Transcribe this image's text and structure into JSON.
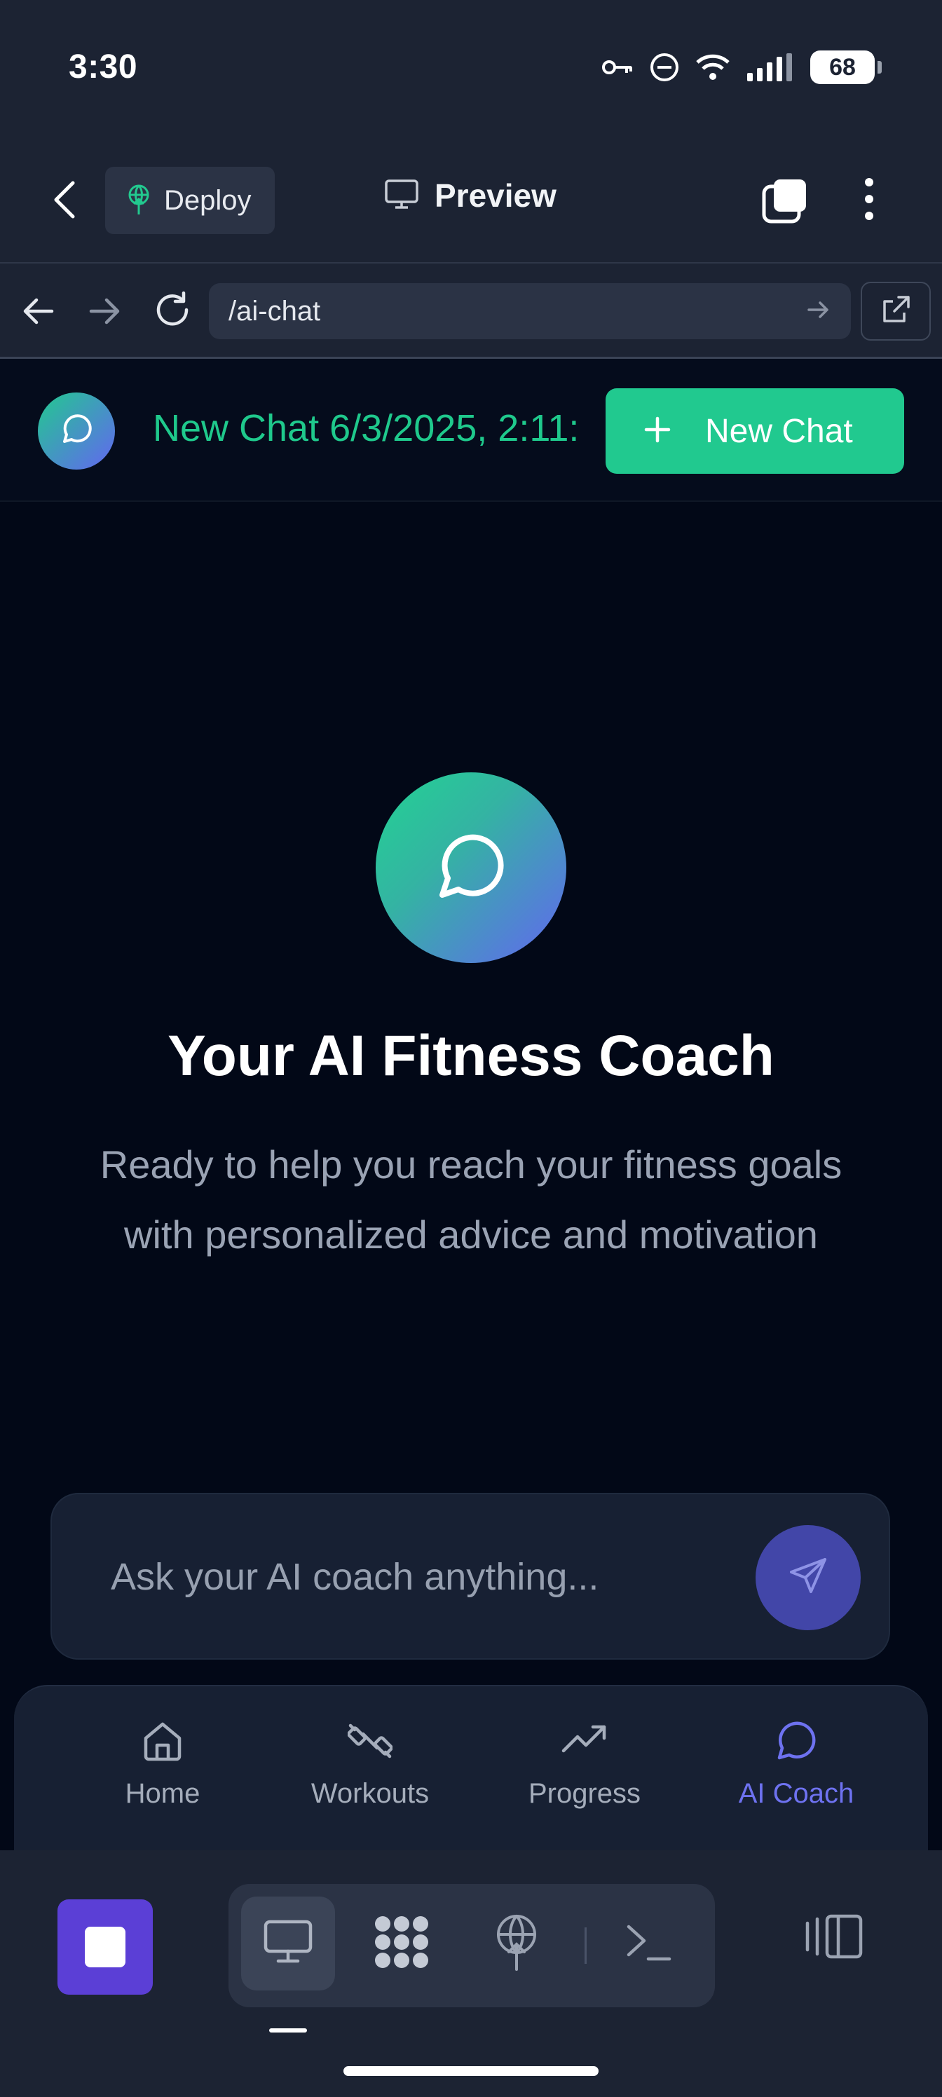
{
  "status_bar": {
    "time": "3:30",
    "battery": "68",
    "icons": [
      "key-icon",
      "dnd-icon",
      "wifi-icon",
      "signal-icon",
      "battery-icon"
    ]
  },
  "toolbar": {
    "deploy_label": "Deploy",
    "preview_label": "Preview",
    "icons": [
      "chevron-left-icon",
      "deploy-icon",
      "monitor-icon",
      "tabs-icon",
      "more-vertical-icon"
    ]
  },
  "browser": {
    "url": "/ai-chat"
  },
  "chat_header": {
    "title": "New Chat 6/3/2025, 2:11:",
    "new_chat_label": "New Chat"
  },
  "hero": {
    "title": "Your AI Fitness Coach",
    "subtitle": "Ready to help you reach your fitness goals with personalized advice and motivation"
  },
  "input": {
    "placeholder": "Ask your AI coach anything...",
    "value": ""
  },
  "bottom_nav": {
    "items": [
      {
        "label": "Home",
        "icon": "home-icon",
        "active": false
      },
      {
        "label": "Workouts",
        "icon": "dumbbell-icon",
        "active": false
      },
      {
        "label": "Progress",
        "icon": "trending-up-icon",
        "active": false
      },
      {
        "label": "AI Coach",
        "icon": "message-circle-icon",
        "active": true
      }
    ]
  },
  "dock": {
    "items": [
      "stop-icon",
      "monitor-icon",
      "apps-grid-icon",
      "deploy-icon",
      "terminal-icon",
      "panel-icon"
    ]
  },
  "colors": {
    "accent_green": "#21c98f",
    "accent_indigo": "#6366f1",
    "app_bg": "#020817",
    "chrome_bg": "#1c2333"
  }
}
